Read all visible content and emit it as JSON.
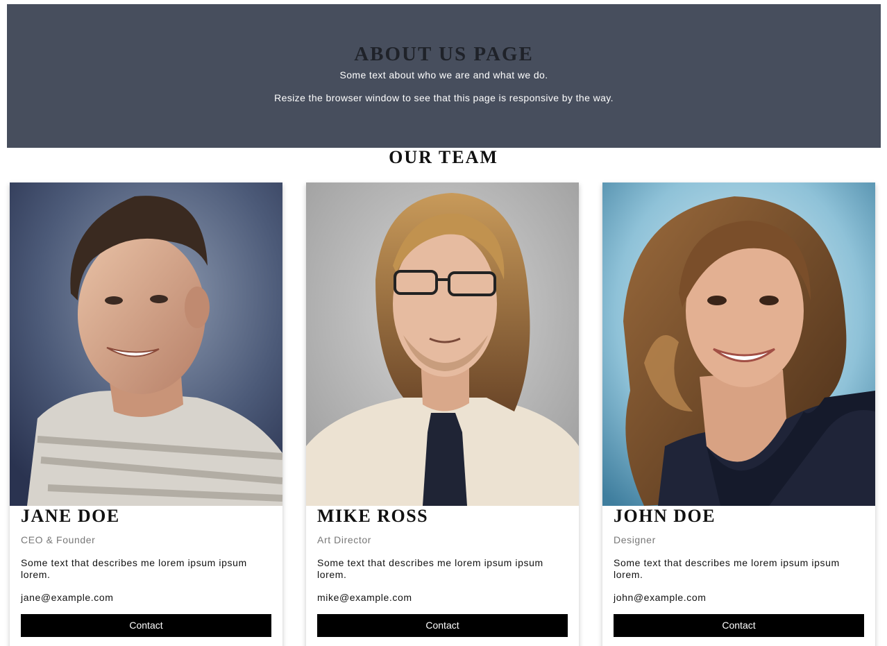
{
  "header": {
    "title": "ABOUT US PAGE",
    "line1": "Some text about who we are and what we do.",
    "line2": "Resize the browser window to see that this page is responsive by the way."
  },
  "team": {
    "heading": "OUR TEAM",
    "members": [
      {
        "name": "JANE DOE",
        "role": "CEO & Founder",
        "description": "Some text that describes me lorem ipsum ipsum lorem.",
        "email": "jane@example.com",
        "button_label": "Contact",
        "photo": "portrait-young-man-striped-shirt"
      },
      {
        "name": "MIKE ROSS",
        "role": "Art Director",
        "description": "Some text that describes me lorem ipsum ipsum lorem.",
        "email": "mike@example.com",
        "button_label": "Contact",
        "photo": "portrait-long-haired-man-glasses-tie"
      },
      {
        "name": "JOHN DOE",
        "role": "Designer",
        "description": "Some text that describes me lorem ipsum ipsum lorem.",
        "email": "john@example.com",
        "button_label": "Contact",
        "photo": "portrait-curly-haired-woman"
      }
    ]
  },
  "colors": {
    "banner": "#474e5d",
    "button": "#000000",
    "role_text": "#777777"
  }
}
